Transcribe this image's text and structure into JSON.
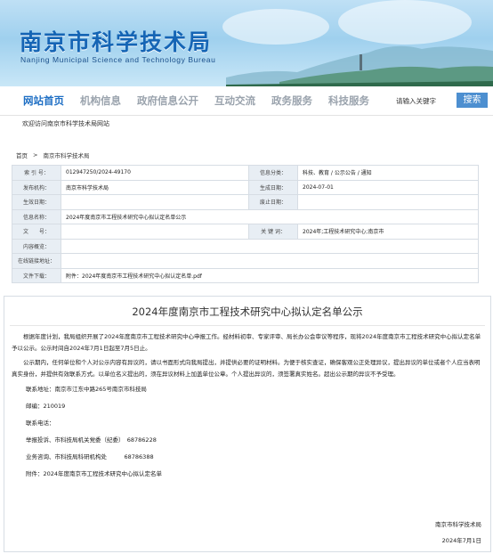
{
  "banner": {
    "title": "南京市科学技术局",
    "subtitle": "Nanjing Municipal Science and Technology Bureau"
  },
  "nav": {
    "items": [
      "网站首页",
      "机构信息",
      "政府信息公开",
      "互动交流",
      "政务服务",
      "科技服务"
    ],
    "search_placeholder": "请输入关键字",
    "search_button": "搜索"
  },
  "welcome": "欢迎访问南京市科学技术局网站",
  "breadcrumb": {
    "home": "首页",
    "separator": ">",
    "current": "南京市科学技术局"
  },
  "info": {
    "index_no_label": "索 引 号：",
    "index_no": "012947250/2024-49170",
    "category_label": "信息分类：",
    "category": "科技、教育 / 公示公告 / 通知",
    "issuer_label": "发布机构：",
    "issuer": "南京市科学技术局",
    "gen_date_label": "生成日期：",
    "gen_date": "2024-07-01",
    "effective_label": "生效日期：",
    "effective": "",
    "abolish_label": "废止日期：",
    "abolish": "",
    "name_label": "信息名称：",
    "name": "2024年度南京市工程技术研究中心拟认定名单公示",
    "doc_no_label": "文　　号：",
    "doc_no": "",
    "keywords_label": "关 键 词：",
    "keywords": "2024年;工程技术研究中心;南京市",
    "summary_label": "内容概览：",
    "summary": "",
    "online_label": "在线链接地址：",
    "online": "",
    "download_label": "文件下载：",
    "download": "附件：2024年度南京市工程技术研究中心拟认定名单.pdf"
  },
  "article": {
    "title": "2024年度南京市工程技术研究中心拟认定名单公示",
    "p1": "根据年度计划，我局组织开展了2024年度南京市工程技术研究中心申报工作。经材料初审、专家评审、局长办公会审议等程序，现将2024年度南京市工程技术研究中心拟认定名单予以公示。公示时间自2024年7月1日起至7月5日止。",
    "p2": "公示期内，任何单位和个人对公示内容有异议的，请以书面形式向我局提出，并提供必要的证明材料。为便于核实查证，确保客观公正处理异议，提出异议的单位或者个人应当表明真实身份，并提供有效联系方式。以单位名义提出的，须在异议材料上加盖单位公章。个人提出异议的，须签署真实姓名。超出公示期的异议不予受理。",
    "address": "联系地址：南京市江东中路265号南京市科技局",
    "postcode": "邮编：210019",
    "phone_label": "联系电话：",
    "report_phone": "举报投诉、市科技局机关党委（纪委）　68786228",
    "business_phone": "业务咨询、市科技局科研机构处　　　68786388",
    "attachment": "附件：2024年度南京市工程技术研究中心拟认定名单",
    "sign_org": "南京市科学技术局",
    "sign_date": "2024年7月1日"
  }
}
